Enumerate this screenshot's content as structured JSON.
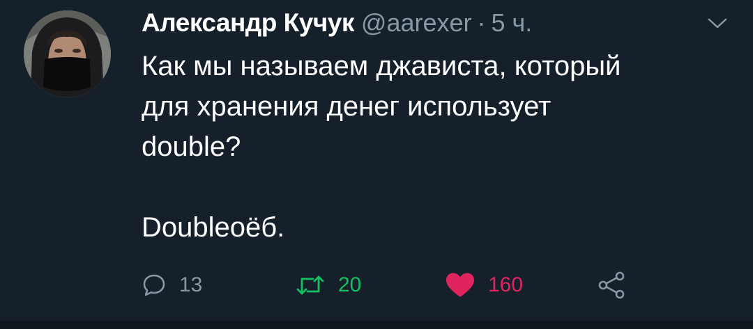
{
  "tweet": {
    "author_name": "Александр Кучук",
    "author_handle": "@aarexer",
    "separator": "·",
    "time_ago": "5 ч.",
    "text": "Как мы называем джависта, который\nдля хранения денег использует\ndouble?\n\nDoubleоёб.",
    "avatar_icon": "user-avatar-masked-hood"
  },
  "actions": {
    "reply": {
      "icon": "reply-bubble-icon",
      "count": "13"
    },
    "retweet": {
      "icon": "retweet-icon",
      "count": "20"
    },
    "like": {
      "icon": "heart-icon",
      "count": "160"
    },
    "share": {
      "icon": "share-icon"
    }
  },
  "colors": {
    "background": "#15202b",
    "text": "#ffffff",
    "muted": "#8899a6",
    "retweet_green": "#17bf63",
    "like_red": "#e0245e"
  }
}
